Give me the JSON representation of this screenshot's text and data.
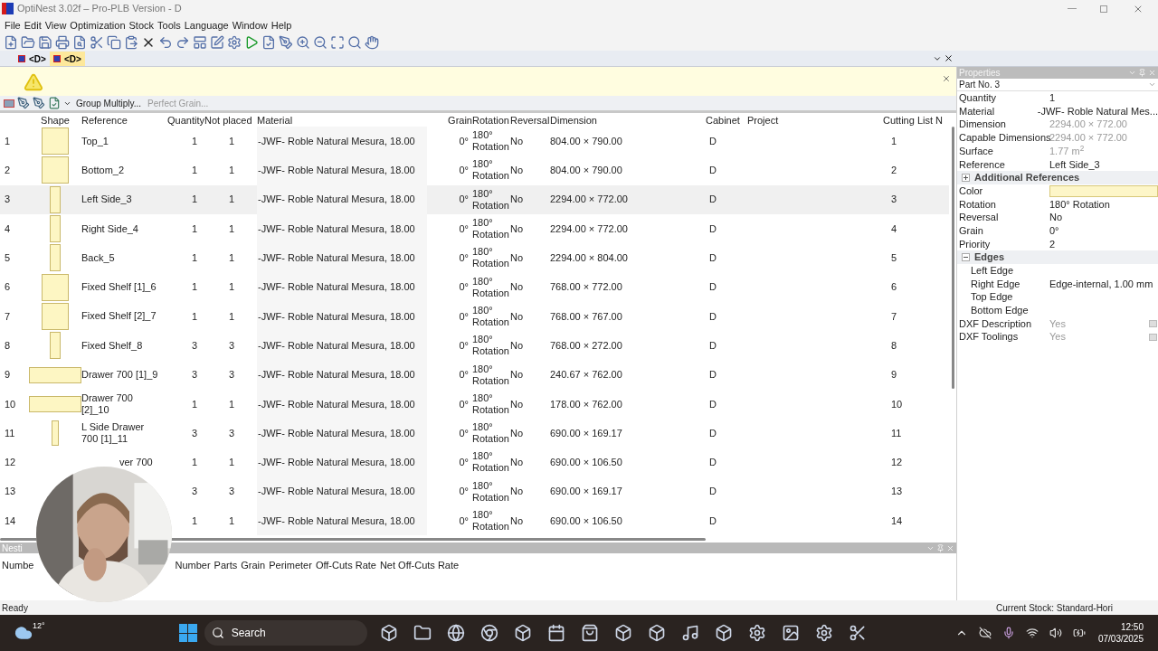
{
  "window": {
    "title": "OptiNest 3.02f – Pro-PLB Version - D"
  },
  "menu": [
    "File",
    "Edit",
    "View",
    "Optimization",
    "Stock",
    "Tools",
    "Language",
    "Window",
    "Help"
  ],
  "doc_tabs": [
    {
      "label": "<D>",
      "selected": false
    },
    {
      "label": "<D>",
      "selected": true
    }
  ],
  "grid_toolbar": {
    "buttons": [
      "Group Multiply...",
      "Perfect Grain..."
    ]
  },
  "table": {
    "columns": [
      "Shape",
      "Reference",
      "Quantity",
      "Not placed",
      "Material",
      "Grain",
      "Rotation",
      "Reversal",
      "Dimension",
      "Cabinet",
      "Project",
      "Cutting List N"
    ],
    "rows": [
      {
        "num": "1",
        "kind": "square",
        "reference": "Top_1",
        "quantity": "1",
        "not_placed": "1",
        "material": "-JWF- Roble Natural Mesura, 18.00",
        "grain": "0°",
        "rotation": "180° Rotation",
        "reversal": "No",
        "dimension": "804.00 × 790.00",
        "cabinet": "D",
        "cutting_list": "1",
        "selected": false
      },
      {
        "num": "2",
        "kind": "square",
        "reference": "Bottom_2",
        "quantity": "1",
        "not_placed": "1",
        "material": "-JWF- Roble Natural Mesura, 18.00",
        "grain": "0°",
        "rotation": "180° Rotation",
        "reversal": "No",
        "dimension": "804.00 × 790.00",
        "cabinet": "D",
        "cutting_list": "2",
        "selected": false
      },
      {
        "num": "3",
        "kind": "tall",
        "reference": "Left Side_3",
        "quantity": "1",
        "not_placed": "1",
        "material": "-JWF- Roble Natural Mesura, 18.00",
        "grain": "0°",
        "rotation": "180° Rotation",
        "reversal": "No",
        "dimension": "2294.00 × 772.00",
        "cabinet": "D",
        "cutting_list": "3",
        "selected": true
      },
      {
        "num": "4",
        "kind": "tall",
        "reference": "Right Side_4",
        "quantity": "1",
        "not_placed": "1",
        "material": "-JWF- Roble Natural Mesura, 18.00",
        "grain": "0°",
        "rotation": "180° Rotation",
        "reversal": "No",
        "dimension": "2294.00 × 772.00",
        "cabinet": "D",
        "cutting_list": "4",
        "selected": false
      },
      {
        "num": "5",
        "kind": "tall",
        "reference": "Back_5",
        "quantity": "1",
        "not_placed": "1",
        "material": "-JWF- Roble Natural Mesura, 18.00",
        "grain": "0°",
        "rotation": "180° Rotation",
        "reversal": "No",
        "dimension": "2294.00 × 804.00",
        "cabinet": "D",
        "cutting_list": "5",
        "selected": false
      },
      {
        "num": "6",
        "kind": "square",
        "reference": "Fixed Shelf [1]_6",
        "quantity": "1",
        "not_placed": "1",
        "material": "-JWF- Roble Natural Mesura, 18.00",
        "grain": "0°",
        "rotation": "180° Rotation",
        "reversal": "No",
        "dimension": "768.00 × 772.00",
        "cabinet": "D",
        "cutting_list": "6",
        "selected": false
      },
      {
        "num": "7",
        "kind": "square",
        "reference": "Fixed Shelf [2]_7",
        "quantity": "1",
        "not_placed": "1",
        "material": "-JWF- Roble Natural Mesura, 18.00",
        "grain": "0°",
        "rotation": "180° Rotation",
        "reversal": "No",
        "dimension": "768.00 × 767.00",
        "cabinet": "D",
        "cutting_list": "7",
        "selected": false
      },
      {
        "num": "8",
        "kind": "tall",
        "reference": "Fixed Shelf_8",
        "quantity": "3",
        "not_placed": "3",
        "material": "-JWF- Roble Natural Mesura, 18.00",
        "grain": "0°",
        "rotation": "180° Rotation",
        "reversal": "No",
        "dimension": "768.00 × 272.00",
        "cabinet": "D",
        "cutting_list": "8",
        "selected": false
      },
      {
        "num": "9",
        "kind": "wide",
        "reference": "Drawer 700 [1]_9",
        "quantity": "3",
        "not_placed": "3",
        "material": "-JWF- Roble Natural Mesura, 18.00",
        "grain": "0°",
        "rotation": "180° Rotation",
        "reversal": "No",
        "dimension": "240.67 × 762.00",
        "cabinet": "D",
        "cutting_list": "9",
        "selected": false
      },
      {
        "num": "10",
        "kind": "wide",
        "reference": "Drawer 700 [2]_10",
        "quantity": "1",
        "not_placed": "1",
        "material": "-JWF- Roble Natural Mesura, 18.00",
        "grain": "0°",
        "rotation": "180° Rotation",
        "reversal": "No",
        "dimension": "178.00 × 762.00",
        "cabinet": "D",
        "cutting_list": "10",
        "selected": false
      },
      {
        "num": "11",
        "kind": "narrow",
        "reference": "L Side Drawer 700 [1]_11",
        "quantity": "3",
        "not_placed": "3",
        "material": "-JWF- Roble Natural Mesura, 18.00",
        "grain": "0°",
        "rotation": "180° Rotation",
        "reversal": "No",
        "dimension": "690.00 × 169.17",
        "cabinet": "D",
        "cutting_list": "11",
        "selected": false
      },
      {
        "num": "12",
        "reference": "ver 700",
        "quantity": "1",
        "not_placed": "1",
        "material": "-JWF- Roble Natural Mesura, 18.00",
        "grain": "0°",
        "rotation": "180° Rotation",
        "reversal": "No",
        "dimension": "690.00 × 106.50",
        "cabinet": "D",
        "cutting_list": "12",
        "selected": false
      },
      {
        "num": "13",
        "quantity": "3",
        "not_placed": "3",
        "material": "-JWF- Roble Natural Mesura, 18.00",
        "grain": "0°",
        "rotation": "180° Rotation",
        "reversal": "No",
        "dimension": "690.00 × 169.17",
        "cabinet": "D",
        "cutting_list": "13",
        "selected": false
      },
      {
        "num": "14",
        "quantity": "1",
        "not_placed": "1",
        "material": "-JWF- Roble Natural Mesura, 18.00",
        "grain": "0°",
        "rotation": "180° Rotation",
        "reversal": "No",
        "dimension": "690.00 × 106.50",
        "cabinet": "D",
        "cutting_list": "14",
        "selected": false
      }
    ]
  },
  "nesting": {
    "title": "Nesti",
    "columns": [
      "Numbe",
      "Number",
      "Parts",
      "Grain",
      "Perimeter",
      "Off-Cuts Rate",
      "Net Off-Cuts Rate"
    ]
  },
  "properties": {
    "title": "Properties",
    "selector": "Part No. 3",
    "items": [
      {
        "kind": "row",
        "label": "Quantity",
        "value": "1",
        "disabled": false
      },
      {
        "kind": "row",
        "label": "Material",
        "value": "-JWF- Roble Natural Mes...",
        "disabled": false
      },
      {
        "kind": "row",
        "label": "Dimension",
        "value": "2294.00 × 772.00",
        "disabled": true
      },
      {
        "kind": "row",
        "label": "Capable Dimensions",
        "value": "2294.00 × 772.00",
        "disabled": true
      },
      {
        "kind": "row",
        "label": "Surface",
        "value": "1.77 m$^{2}$",
        "disabled": true
      },
      {
        "kind": "row",
        "label": "Reference",
        "value": "Left Side_3",
        "disabled": false
      },
      {
        "kind": "group",
        "label": "Additional References",
        "expanded": false
      },
      {
        "kind": "color",
        "label": "Color",
        "color": "#fdf6c8"
      },
      {
        "kind": "row",
        "label": "Rotation",
        "value": "180° Rotation",
        "disabled": false
      },
      {
        "kind": "row",
        "label": "Reversal",
        "value": "No",
        "disabled": false
      },
      {
        "kind": "row",
        "label": "Grain",
        "value": "0°",
        "disabled": false
      },
      {
        "kind": "row",
        "label": "Priority",
        "value": "2",
        "disabled": false
      },
      {
        "kind": "group",
        "label": "Edges",
        "expanded": true,
        "children": [
          {
            "kind": "row",
            "label": "Left Edge"
          },
          {
            "kind": "row",
            "label": "Right Edge",
            "value": "Edge-internal, 1.00 mm"
          },
          {
            "kind": "row",
            "label": "Top Edge"
          },
          {
            "kind": "row",
            "label": "Bottom Edge"
          }
        ]
      },
      {
        "kind": "button",
        "label": "DXF Description",
        "value": "Yes",
        "disabled": true
      },
      {
        "kind": "button",
        "label": "DXF Toolings",
        "value": "Yes",
        "disabled": true
      }
    ]
  },
  "status_bar": {
    "left": "Ready",
    "right": "Current Stock: Standard-Hori"
  },
  "taskbar": {
    "weather": "12°",
    "search": "Search",
    "time": "12:50",
    "date": "07/03/2025"
  }
}
